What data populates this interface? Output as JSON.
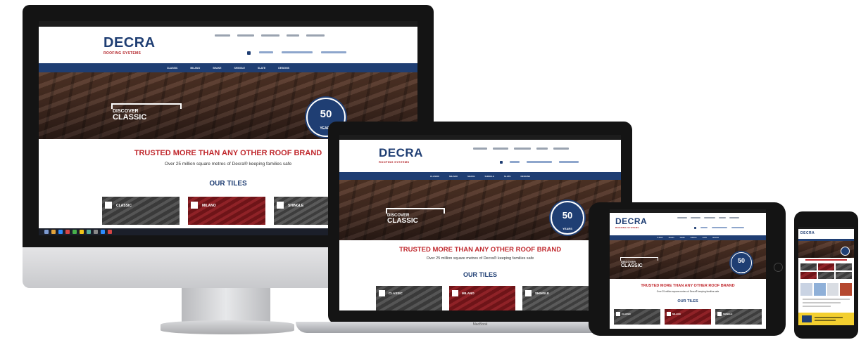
{
  "site": {
    "logo": "DECRA",
    "logo_sub": "ROOFING SYSTEMS",
    "nav_items": [
      "CLASSIC",
      "MILANO",
      "SHAKE",
      "SHINGLE",
      "SLATE",
      "DESIGNS"
    ],
    "hero": {
      "discover": "DISCOVER",
      "product": "CLASSIC"
    },
    "badge": {
      "number": "50",
      "text": "YEARS"
    },
    "headline": "TRUSTED MORE THAN ANY OTHER ROOF BRAND",
    "subline": "Over 25 million square metres of Decra® keeping families safe",
    "section_title": "OUR TILES",
    "tiles": [
      "CLASSIC",
      "MILANO",
      "SHINGLE"
    ]
  },
  "devices": {
    "laptop_label": "MacBook"
  },
  "colors": {
    "brand_blue": "#1f3e73",
    "brand_red": "#c0282d",
    "device_dark": "#151515"
  }
}
